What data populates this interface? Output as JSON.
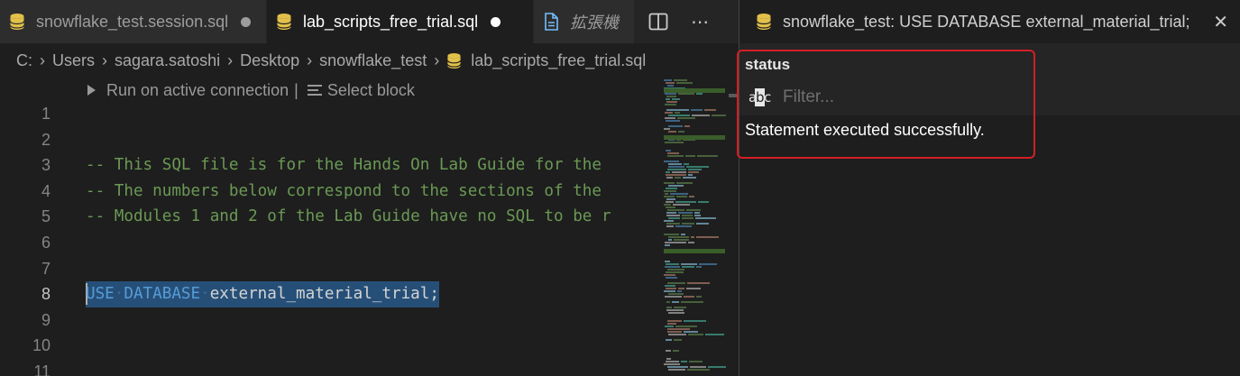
{
  "tabs": [
    {
      "label": "snowflake_test.session.sql",
      "icon": "database-icon",
      "dirty": true,
      "active": false
    },
    {
      "label": "lab_scripts_free_trial.sql",
      "icon": "database-icon",
      "dirty": true,
      "active": true
    },
    {
      "label": "拡張機",
      "icon": "file-icon",
      "dirty": false,
      "active": false,
      "italic": true
    }
  ],
  "tab_actions": {
    "split": "split-editor-icon",
    "more": "⋯"
  },
  "breadcrumb": [
    "C:",
    "Users",
    "sagara.satoshi",
    "Desktop",
    "snowflake_test",
    "lab_scripts_free_trial.sql"
  ],
  "codelens": {
    "run": "Run on active connection",
    "separator": "|",
    "select": "Select block"
  },
  "code_lines": [
    {
      "n": "1",
      "text": ""
    },
    {
      "n": "2",
      "text": ""
    },
    {
      "n": "3",
      "text": "-- This SQL file is for the Hands On Lab Guide for the"
    },
    {
      "n": "4",
      "text": "-- The numbers below correspond to the sections of the"
    },
    {
      "n": "5",
      "text": "-- Modules 1 and 2 of the Lab Guide have no SQL to be r"
    },
    {
      "n": "6",
      "text": ""
    },
    {
      "n": "7",
      "text": ""
    },
    {
      "n": "8",
      "kw1": "USE",
      "kw2": "DATABASE",
      "ident": "external_material_trial;"
    },
    {
      "n": "9",
      "text": ""
    },
    {
      "n": "10",
      "text": ""
    },
    {
      "n": "11",
      "text": ""
    }
  ],
  "right_tab": {
    "label": "snowflake_test: USE DATABASE external_material_trial;",
    "close": "✕"
  },
  "status_panel": {
    "title": "status",
    "filter_placeholder": "Filter...",
    "message": "Statement executed successfully."
  },
  "colors": {
    "comment": "#6a9955",
    "keyword": "#569cd6",
    "selection": "#264f78",
    "highlight_box": "#d31f26",
    "db_icon": "#e2c04a"
  }
}
